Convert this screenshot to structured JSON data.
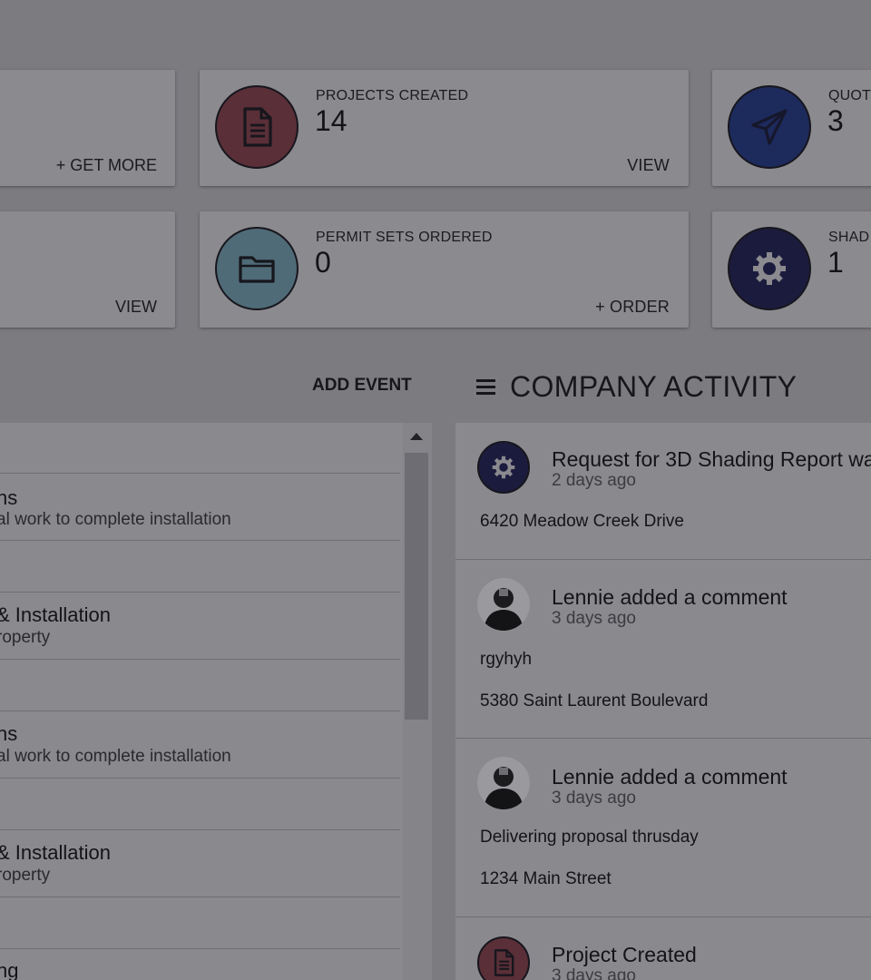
{
  "stats_top": [
    {
      "action": "+ GET MORE"
    },
    {
      "title": "PROJECTS CREATED",
      "count": "14",
      "action": "VIEW",
      "icon": "document-icon",
      "color": "#5a2f38"
    },
    {
      "title": "QUOT",
      "count": "3",
      "icon": "paper-plane-icon",
      "color": "#1d2a5c"
    }
  ],
  "stats_bottom": [
    {
      "action": "VIEW"
    },
    {
      "title": "PERMIT SETS ORDERED",
      "count": "0",
      "action": "+ ORDER",
      "icon": "folder-icon",
      "color": "#4f6b77"
    },
    {
      "title": "SHAD",
      "count": "1",
      "icon": "gear-icon",
      "color": "#1b1c3d"
    }
  ],
  "schedule": {
    "add_event_label": "ADD EVENT",
    "rows": [
      {
        "title": "ns",
        "desc": "al work to complete installation"
      },
      {
        "title": "& Installation",
        "desc": "roperty"
      },
      {
        "title": "ns",
        "desc": "al work to complete installation"
      },
      {
        "title": "& Installation",
        "desc": "roperty"
      },
      {
        "title": "ng",
        "desc": ""
      }
    ]
  },
  "activity": {
    "header": "COMPANY ACTIVITY",
    "items": [
      {
        "headline": "Request for 3D Shading Report wa",
        "time": "2 days ago",
        "lines": [
          "6420 Meadow Creek Drive"
        ],
        "icon": "gear-icon"
      },
      {
        "headline": "Lennie added a comment",
        "time": "3 days ago",
        "lines": [
          "rgyhyh",
          "5380 Saint Laurent Boulevard"
        ],
        "icon": "avatar"
      },
      {
        "headline": "Lennie added a comment",
        "time": "3 days ago",
        "lines": [
          "Delivering proposal thrusday",
          "1234 Main Street"
        ],
        "icon": "avatar"
      },
      {
        "headline": "Project Created",
        "time": "3 days ago",
        "lines": [],
        "icon": "document-icon"
      }
    ]
  }
}
